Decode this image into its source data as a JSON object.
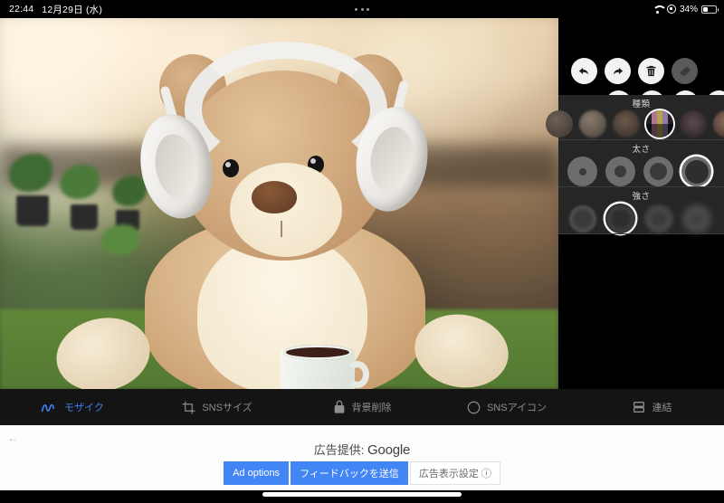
{
  "status_bar": {
    "time": "22:44",
    "date": "12月29日 (水)",
    "battery_percent": "34%",
    "icons": [
      "wifi-icon",
      "rotation-lock-icon",
      "battery-icon"
    ],
    "multitask_handle": "three-dots-handle"
  },
  "canvas": {
    "subject": "teddy-bear-with-headphones-photo",
    "description": "編集中の写真"
  },
  "tool_panel": {
    "actions_row1": [
      {
        "name": "undo-button",
        "icon": "undo-arrow-icon",
        "enabled": true
      },
      {
        "name": "redo-button",
        "icon": "redo-arrow-icon",
        "enabled": true
      },
      {
        "name": "delete-button",
        "icon": "trash-icon",
        "enabled": true
      },
      {
        "name": "eraser-button",
        "icon": "eraser-icon",
        "enabled": false
      }
    ],
    "actions_row2": [
      {
        "name": "camera-button",
        "icon": "camera-icon",
        "enabled": true
      },
      {
        "name": "gallery-button",
        "icon": "photo-icon",
        "enabled": true
      },
      {
        "name": "save-button",
        "icon": "download-arrow-icon",
        "enabled": true
      },
      {
        "name": "store-button",
        "icon": "shopping-cart-icon",
        "enabled": true
      }
    ],
    "sections": [
      {
        "key": "type",
        "label": "種類",
        "selected_index": 2,
        "options": [
          "mosaic-type-1",
          "mosaic-type-2",
          "mosaic-type-3",
          "mosaic-type-4",
          "mosaic-type-5",
          "mosaic-type-6"
        ]
      },
      {
        "key": "thickness",
        "label": "太さ",
        "selected_index": 3,
        "options": [
          "thickness-1",
          "thickness-2",
          "thickness-3",
          "thickness-4"
        ]
      },
      {
        "key": "strength",
        "label": "強さ",
        "selected_index": 1,
        "options": [
          "strength-1",
          "strength-2",
          "strength-3",
          "strength-4"
        ]
      }
    ]
  },
  "feature_bar": {
    "active_index": 0,
    "items": [
      {
        "label": "モザイク",
        "icon": "scribble-icon"
      },
      {
        "label": "SNSサイズ",
        "icon": "crop-icon"
      },
      {
        "label": "背景削除",
        "icon": "lock-icon"
      },
      {
        "label": "SNSアイコン",
        "icon": "circle-icon"
      },
      {
        "label": "連結",
        "icon": "stacked-rectangles-icon"
      }
    ]
  },
  "ad": {
    "back_icon": "back-arrow-icon",
    "provider_prefix": "広告提供: ",
    "provider_brand": "Google",
    "buttons": [
      {
        "label": "Ad options",
        "style": "blue"
      },
      {
        "label": "フィードバックを送信",
        "style": "blue"
      },
      {
        "label": "広告表示設定 ⓘ",
        "style": "plain"
      }
    ]
  },
  "colors": {
    "accent_blue": "#3f7ff0",
    "ad_blue": "#4285f4",
    "panel_bg": "#262626",
    "toolbar_bg": "#2b2b2b"
  }
}
